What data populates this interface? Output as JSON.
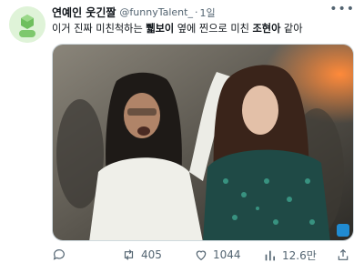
{
  "tweet": {
    "display_name": "연예인 웃긴짤",
    "handle": "@funnyTalent_",
    "separator": "·",
    "time": "1일",
    "more": "•••",
    "text_parts": [
      "이거 진짜 미친척하는 ",
      "쀏보이",
      " 옆에 찐으로 미친 ",
      "조현아",
      " 같아"
    ]
  },
  "actions": {
    "reply_count": "",
    "retweet_count": "405",
    "like_count": "1044",
    "view_count": "12.6만"
  },
  "icons": [
    "avatar-icon",
    "more-icon",
    "reply-icon",
    "retweet-icon",
    "like-icon",
    "views-icon",
    "share-icon"
  ],
  "colors": {
    "text": "#0f1419",
    "secondary": "#536471",
    "border": "#cfd9de",
    "avatar_bg": "#dff3d8"
  }
}
